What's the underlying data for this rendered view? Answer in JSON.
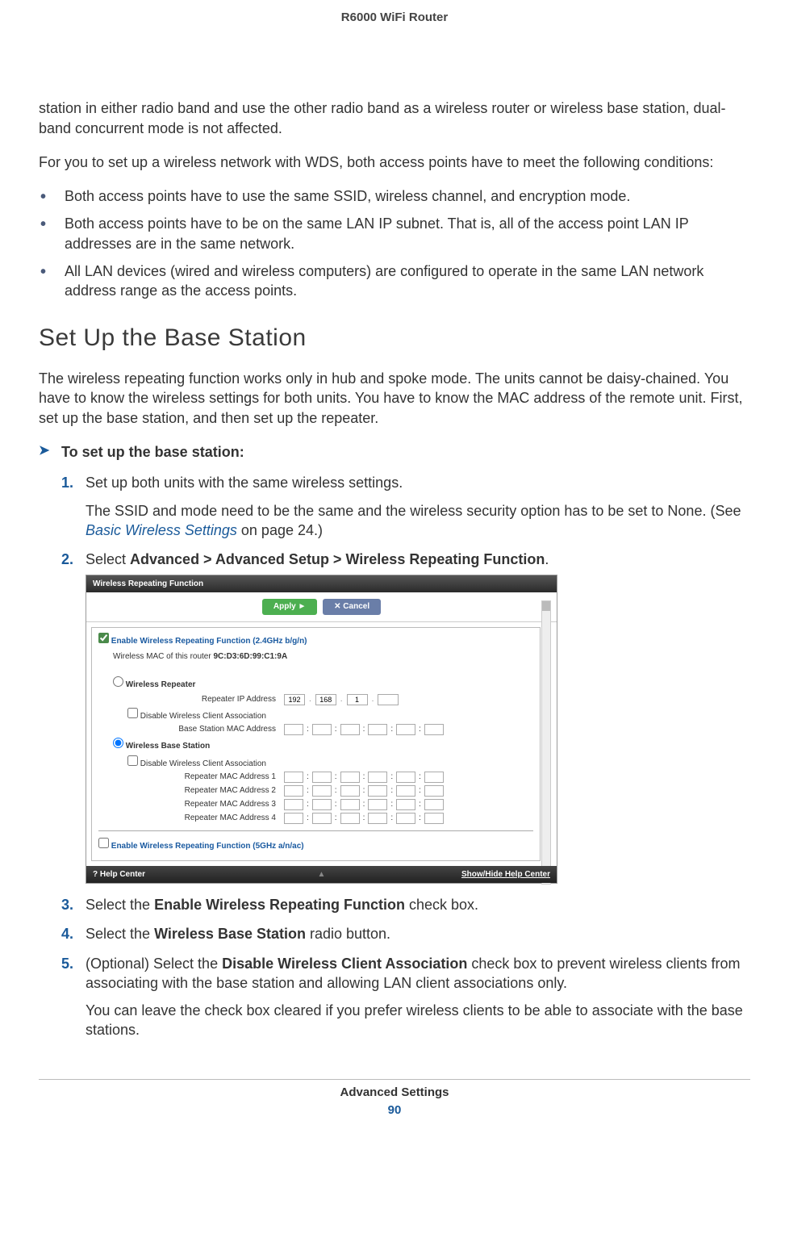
{
  "header": {
    "title": "R6000 WiFi Router"
  },
  "intro": {
    "p1": "station in either radio band and use the other radio band as a wireless router or wireless base station, dual-band concurrent mode is not affected.",
    "p2": "For you to set up a wireless network with WDS, both access points have to meet the following conditions:",
    "bullets": [
      "Both access points have to use the same SSID, wireless channel, and encryption mode.",
      "Both access points have to be on the same LAN IP subnet. That is, all of the access point LAN IP addresses are in the same network.",
      "All LAN devices (wired and wireless computers) are configured to operate in the same LAN network address range as the access points."
    ]
  },
  "section": {
    "heading": "Set Up the Base Station",
    "lead": "The wireless repeating function works only in hub and spoke mode. The units cannot be daisy-chained. You have to know the wireless settings for both units. You have to know the MAC address of the remote unit. First, set up the base station, and then set up the repeater.",
    "procedure_title": "To set up the base station:",
    "steps": {
      "s1": {
        "num": "1.",
        "text": "Set up both units with the same wireless settings.",
        "body_pre": "The SSID and mode need to be the same and the wireless security option has to be set to None. (See ",
        "body_link": "Basic Wireless Settings",
        "body_post": " on page 24.)"
      },
      "s2": {
        "num": "2.",
        "pre": "Select ",
        "bold": "Advanced > Advanced Setup > Wireless Repeating Function",
        "post": "."
      },
      "s3": {
        "num": "3.",
        "pre": "Select the ",
        "bold": "Enable Wireless Repeating Function",
        "post": " check box."
      },
      "s4": {
        "num": "4.",
        "pre": "Select the ",
        "bold": "Wireless Base Station",
        "post": " radio button."
      },
      "s5": {
        "num": "5.",
        "pre": "(Optional) Select the ",
        "bold": "Disable Wireless Client Association",
        "post": " check box to prevent wireless clients from associating with the base station and allowing LAN client associations only.",
        "body": "You can leave the check box cleared if you prefer wireless clients to be able to associate with the base stations."
      }
    }
  },
  "router_ui": {
    "title": "Wireless Repeating Function",
    "apply": "Apply ►",
    "cancel": "✕ Cancel",
    "enable_24": "Enable Wireless Repeating Function (2.4GHz b/g/n)",
    "mac_label": "Wireless MAC of this router",
    "mac_value": "9C:D3:6D:99:C1:9A",
    "repeater_label": "Wireless Repeater",
    "repeater_ip": "Repeater IP Address",
    "ip_oct": [
      "192",
      "168",
      "1",
      ""
    ],
    "disable_assoc": "Disable Wireless Client Association",
    "base_mac_label": "Base Station MAC Address",
    "base_station_label": "Wireless Base Station",
    "rep_mac1": "Repeater MAC Address 1",
    "rep_mac2": "Repeater MAC Address 2",
    "rep_mac3": "Repeater MAC Address 3",
    "rep_mac4": "Repeater MAC Address 4",
    "enable_5": "Enable Wireless Repeating Function (5GHz a/n/ac)",
    "help_center": "Help Center",
    "show_hide": "Show/Hide Help Center"
  },
  "footer": {
    "section": "Advanced Settings",
    "page": "90"
  }
}
